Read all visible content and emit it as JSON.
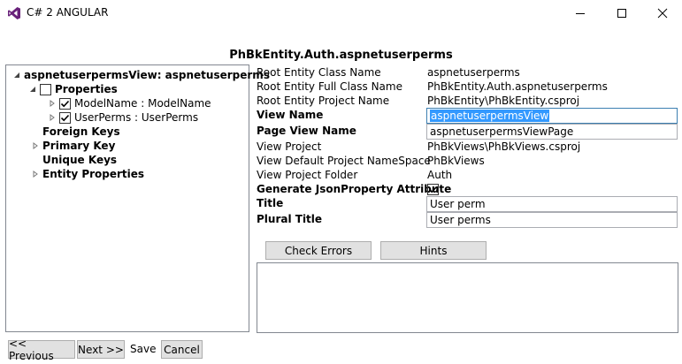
{
  "window": {
    "title": "C# 2 ANGULAR",
    "minimize_icon": "minimize-icon",
    "maximize_icon": "maximize-icon",
    "close_icon": "close-icon",
    "accent_color": "#68217a"
  },
  "header": {
    "title": "PhBkEntity.Auth.aspnetuserperms"
  },
  "tree": {
    "root": "aspnetuserpermsView: aspnetuserperms",
    "properties": "Properties",
    "model_name": "ModelName : ModelName",
    "user_perms": "UserPerms : UserPerms",
    "foreign_keys": "Foreign Keys",
    "primary_key": "Primary Key",
    "unique_keys": "Unique Keys",
    "entity_properties": "Entity Properties"
  },
  "properties": {
    "root_entity_class_name": {
      "label": "Root Entity Class Name",
      "value": "aspnetuserperms"
    },
    "root_entity_full_class_name": {
      "label": "Root Entity Full Class Name",
      "value": "PhBkEntity.Auth.aspnetuserperms"
    },
    "root_entity_project_name": {
      "label": "Root Entity Project Name",
      "value": "PhBkEntity\\PhBkEntity.csproj"
    },
    "view_name": {
      "label": "View Name",
      "value": "aspnetuserpermsView"
    },
    "page_view_name": {
      "label": "Page View Name",
      "value": "aspnetuserpermsViewPage"
    },
    "view_project": {
      "label": "View Project",
      "value": "PhBkViews\\PhBkViews.csproj"
    },
    "view_default_namespace": {
      "label": "View Default Project NameSpace",
      "value": "PhBkViews"
    },
    "view_project_folder": {
      "label": "View Project Folder",
      "value": "Auth"
    },
    "generate_json_property": {
      "label": "Generate JsonProperty Attribute",
      "checked": true
    },
    "title": {
      "label": "Title",
      "value": "User perm"
    },
    "plural_title": {
      "label": "Plural Title",
      "value": "User perms"
    }
  },
  "actions": {
    "check_errors": "Check Errors",
    "hints": "Hints"
  },
  "footer": {
    "previous": "<< Previous",
    "next": "Next >>",
    "save": "Save",
    "cancel": "Cancel"
  }
}
